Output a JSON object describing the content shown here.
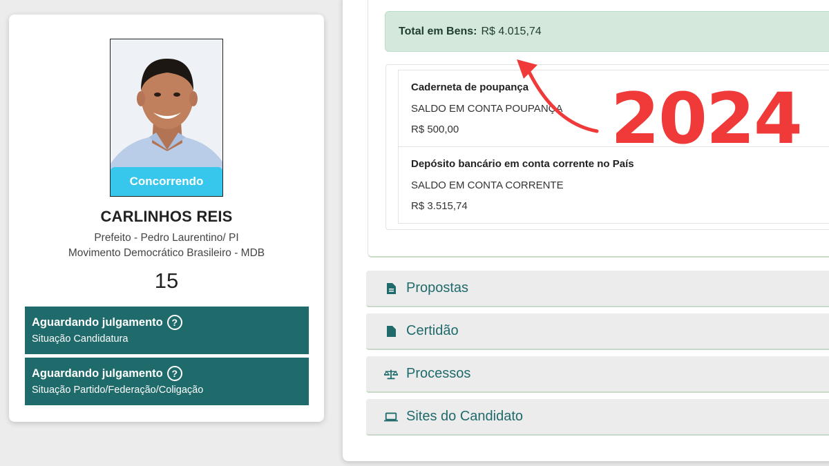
{
  "candidate": {
    "status_badge": "Concorrendo",
    "name": "CARLINHOS REIS",
    "office": "Prefeito - Pedro Laurentino/ PI",
    "party": "Movimento Democrático Brasileiro - MDB",
    "number": "15"
  },
  "situations": [
    {
      "title": "Aguardando julgamento",
      "help": "?",
      "subtitle": "Situação Candidatura"
    },
    {
      "title": "Aguardando julgamento",
      "help": "?",
      "subtitle": "Situação Partido/Federação/Coligação"
    }
  ],
  "assets": {
    "total_label": "Total em Bens:",
    "total_value": "R$ 4.015,74",
    "items": [
      {
        "type": "Caderneta de poupança",
        "description": "SALDO EM CONTA POUPANÇA",
        "value": "R$ 500,00"
      },
      {
        "type": "Depósito bancário em conta corrente no País",
        "description": "SALDO EM CONTA CORRENTE",
        "value": "R$ 3.515,74"
      }
    ]
  },
  "overlay": {
    "year": "2024"
  },
  "sections": [
    {
      "label": "Propostas",
      "icon": "document-icon"
    },
    {
      "label": "Certidão",
      "icon": "document-icon"
    },
    {
      "label": "Processos",
      "icon": "scales-icon"
    },
    {
      "label": "Sites do Candidato",
      "icon": "laptop-icon"
    }
  ],
  "colors": {
    "accent": "#1f6a6b",
    "badge": "#38c7ec",
    "total_bg": "#d4e9dc",
    "overlay_red": "#f03a3a"
  }
}
